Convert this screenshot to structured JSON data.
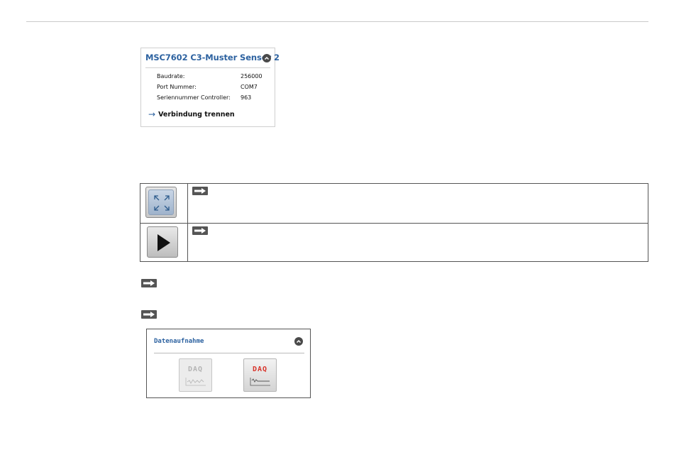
{
  "sensor": {
    "title": "MSC7602 C3-Muster Sensor 2",
    "rows": [
      {
        "label": "Baudrate:",
        "value": "256000"
      },
      {
        "label": "Port Nummer:",
        "value": "COM7"
      },
      {
        "label": "Seriennummer Controller:",
        "value": "963"
      }
    ],
    "link_label": "Verbindung trennen",
    "link_icon": "arrow-right-icon"
  },
  "icon_table": {
    "rows": [
      {
        "icon": "fullscreen-icon"
      },
      {
        "icon": "play-icon"
      }
    ],
    "note_icon": "note-arrow-icon"
  },
  "daq": {
    "title": "Datenaufnahme",
    "buttons": [
      {
        "label": "DAQ",
        "state": "inactive"
      },
      {
        "label": "DAQ",
        "state": "active"
      }
    ]
  },
  "colors": {
    "accent_blue": "#2d62a0",
    "daq_active_red": "#d9342b",
    "daq_inactive_gray": "#b4b4b4"
  }
}
